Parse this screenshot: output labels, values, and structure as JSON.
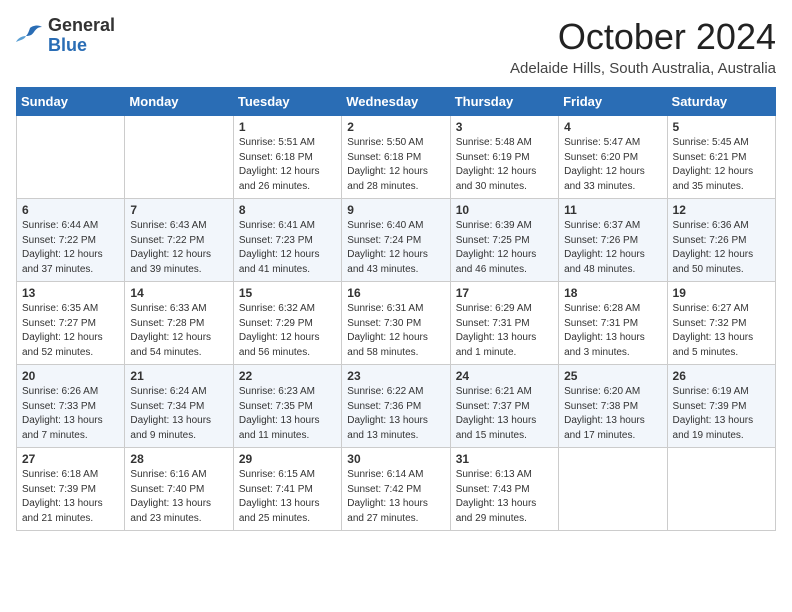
{
  "header": {
    "logo": {
      "general": "General",
      "blue": "Blue"
    },
    "month": "October 2024",
    "location": "Adelaide Hills, South Australia, Australia"
  },
  "weekdays": [
    "Sunday",
    "Monday",
    "Tuesday",
    "Wednesday",
    "Thursday",
    "Friday",
    "Saturday"
  ],
  "weeks": [
    [
      {
        "day": null,
        "sunrise": null,
        "sunset": null,
        "daylight": null
      },
      {
        "day": null,
        "sunrise": null,
        "sunset": null,
        "daylight": null
      },
      {
        "day": "1",
        "sunrise": "Sunrise: 5:51 AM",
        "sunset": "Sunset: 6:18 PM",
        "daylight": "Daylight: 12 hours and 26 minutes."
      },
      {
        "day": "2",
        "sunrise": "Sunrise: 5:50 AM",
        "sunset": "Sunset: 6:18 PM",
        "daylight": "Daylight: 12 hours and 28 minutes."
      },
      {
        "day": "3",
        "sunrise": "Sunrise: 5:48 AM",
        "sunset": "Sunset: 6:19 PM",
        "daylight": "Daylight: 12 hours and 30 minutes."
      },
      {
        "day": "4",
        "sunrise": "Sunrise: 5:47 AM",
        "sunset": "Sunset: 6:20 PM",
        "daylight": "Daylight: 12 hours and 33 minutes."
      },
      {
        "day": "5",
        "sunrise": "Sunrise: 5:45 AM",
        "sunset": "Sunset: 6:21 PM",
        "daylight": "Daylight: 12 hours and 35 minutes."
      }
    ],
    [
      {
        "day": "6",
        "sunrise": "Sunrise: 6:44 AM",
        "sunset": "Sunset: 7:22 PM",
        "daylight": "Daylight: 12 hours and 37 minutes."
      },
      {
        "day": "7",
        "sunrise": "Sunrise: 6:43 AM",
        "sunset": "Sunset: 7:22 PM",
        "daylight": "Daylight: 12 hours and 39 minutes."
      },
      {
        "day": "8",
        "sunrise": "Sunrise: 6:41 AM",
        "sunset": "Sunset: 7:23 PM",
        "daylight": "Daylight: 12 hours and 41 minutes."
      },
      {
        "day": "9",
        "sunrise": "Sunrise: 6:40 AM",
        "sunset": "Sunset: 7:24 PM",
        "daylight": "Daylight: 12 hours and 43 minutes."
      },
      {
        "day": "10",
        "sunrise": "Sunrise: 6:39 AM",
        "sunset": "Sunset: 7:25 PM",
        "daylight": "Daylight: 12 hours and 46 minutes."
      },
      {
        "day": "11",
        "sunrise": "Sunrise: 6:37 AM",
        "sunset": "Sunset: 7:26 PM",
        "daylight": "Daylight: 12 hours and 48 minutes."
      },
      {
        "day": "12",
        "sunrise": "Sunrise: 6:36 AM",
        "sunset": "Sunset: 7:26 PM",
        "daylight": "Daylight: 12 hours and 50 minutes."
      }
    ],
    [
      {
        "day": "13",
        "sunrise": "Sunrise: 6:35 AM",
        "sunset": "Sunset: 7:27 PM",
        "daylight": "Daylight: 12 hours and 52 minutes."
      },
      {
        "day": "14",
        "sunrise": "Sunrise: 6:33 AM",
        "sunset": "Sunset: 7:28 PM",
        "daylight": "Daylight: 12 hours and 54 minutes."
      },
      {
        "day": "15",
        "sunrise": "Sunrise: 6:32 AM",
        "sunset": "Sunset: 7:29 PM",
        "daylight": "Daylight: 12 hours and 56 minutes."
      },
      {
        "day": "16",
        "sunrise": "Sunrise: 6:31 AM",
        "sunset": "Sunset: 7:30 PM",
        "daylight": "Daylight: 12 hours and 58 minutes."
      },
      {
        "day": "17",
        "sunrise": "Sunrise: 6:29 AM",
        "sunset": "Sunset: 7:31 PM",
        "daylight": "Daylight: 13 hours and 1 minute."
      },
      {
        "day": "18",
        "sunrise": "Sunrise: 6:28 AM",
        "sunset": "Sunset: 7:31 PM",
        "daylight": "Daylight: 13 hours and 3 minutes."
      },
      {
        "day": "19",
        "sunrise": "Sunrise: 6:27 AM",
        "sunset": "Sunset: 7:32 PM",
        "daylight": "Daylight: 13 hours and 5 minutes."
      }
    ],
    [
      {
        "day": "20",
        "sunrise": "Sunrise: 6:26 AM",
        "sunset": "Sunset: 7:33 PM",
        "daylight": "Daylight: 13 hours and 7 minutes."
      },
      {
        "day": "21",
        "sunrise": "Sunrise: 6:24 AM",
        "sunset": "Sunset: 7:34 PM",
        "daylight": "Daylight: 13 hours and 9 minutes."
      },
      {
        "day": "22",
        "sunrise": "Sunrise: 6:23 AM",
        "sunset": "Sunset: 7:35 PM",
        "daylight": "Daylight: 13 hours and 11 minutes."
      },
      {
        "day": "23",
        "sunrise": "Sunrise: 6:22 AM",
        "sunset": "Sunset: 7:36 PM",
        "daylight": "Daylight: 13 hours and 13 minutes."
      },
      {
        "day": "24",
        "sunrise": "Sunrise: 6:21 AM",
        "sunset": "Sunset: 7:37 PM",
        "daylight": "Daylight: 13 hours and 15 minutes."
      },
      {
        "day": "25",
        "sunrise": "Sunrise: 6:20 AM",
        "sunset": "Sunset: 7:38 PM",
        "daylight": "Daylight: 13 hours and 17 minutes."
      },
      {
        "day": "26",
        "sunrise": "Sunrise: 6:19 AM",
        "sunset": "Sunset: 7:39 PM",
        "daylight": "Daylight: 13 hours and 19 minutes."
      }
    ],
    [
      {
        "day": "27",
        "sunrise": "Sunrise: 6:18 AM",
        "sunset": "Sunset: 7:39 PM",
        "daylight": "Daylight: 13 hours and 21 minutes."
      },
      {
        "day": "28",
        "sunrise": "Sunrise: 6:16 AM",
        "sunset": "Sunset: 7:40 PM",
        "daylight": "Daylight: 13 hours and 23 minutes."
      },
      {
        "day": "29",
        "sunrise": "Sunrise: 6:15 AM",
        "sunset": "Sunset: 7:41 PM",
        "daylight": "Daylight: 13 hours and 25 minutes."
      },
      {
        "day": "30",
        "sunrise": "Sunrise: 6:14 AM",
        "sunset": "Sunset: 7:42 PM",
        "daylight": "Daylight: 13 hours and 27 minutes."
      },
      {
        "day": "31",
        "sunrise": "Sunrise: 6:13 AM",
        "sunset": "Sunset: 7:43 PM",
        "daylight": "Daylight: 13 hours and 29 minutes."
      },
      {
        "day": null,
        "sunrise": null,
        "sunset": null,
        "daylight": null
      },
      {
        "day": null,
        "sunrise": null,
        "sunset": null,
        "daylight": null
      }
    ]
  ]
}
